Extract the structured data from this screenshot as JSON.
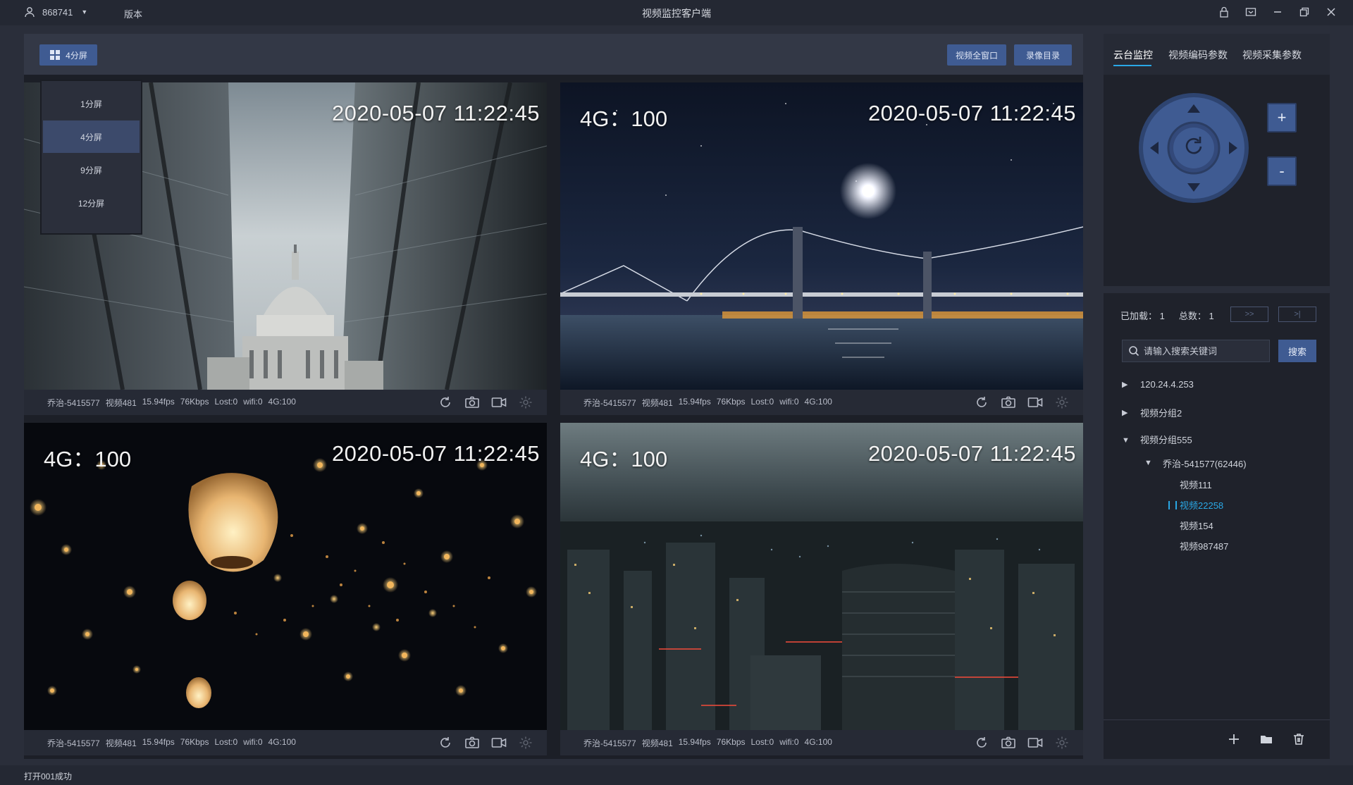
{
  "titlebar": {
    "user_id": "868741",
    "version_label": "版本",
    "app_title": "视频监控客户端"
  },
  "toolbar": {
    "split_label": "4分屏",
    "fullscreen_label": "视频全窗口",
    "record_dir_label": "录像目录"
  },
  "split_menu": {
    "options": [
      "1分屏",
      "4分屏",
      "9分屏",
      "12分屏"
    ],
    "selected": "4分屏"
  },
  "tiles": [
    {
      "signal": "",
      "timestamp": "2020-05-07 11:22:45",
      "status": [
        "乔治-5415577",
        "视频481",
        "15.94fps",
        "76Kbps",
        "Lost:0",
        "wifi:0",
        "4G:100"
      ],
      "selected": true
    },
    {
      "signal": "4G：100",
      "timestamp": "2020-05-07 11:22:45",
      "status": [
        "乔治-5415577",
        "视频481",
        "15.94fps",
        "76Kbps",
        "Lost:0",
        "wifi:0",
        "4G:100"
      ],
      "selected": false
    },
    {
      "signal": "4G：100",
      "timestamp": "2020-05-07 11:22:45",
      "status": [
        "乔治-5415577",
        "视频481",
        "15.94fps",
        "76Kbps",
        "Lost:0",
        "wifi:0",
        "4G:100"
      ],
      "selected": false
    },
    {
      "signal": "4G：100",
      "timestamp": "2020-05-07 11:22:45",
      "status": [
        "乔治-5415577",
        "视频481",
        "15.94fps",
        "76Kbps",
        "Lost:0",
        "wifi:0",
        "4G:100"
      ],
      "selected": false
    }
  ],
  "tile_icons": [
    "refresh-icon",
    "camera-icon",
    "video-record-icon",
    "settings-icon"
  ],
  "right_panel": {
    "tabs": [
      "云台监控",
      "视频编码参数",
      "视频采集参数"
    ],
    "active_tab": "云台监控",
    "zoom_in_label": "+",
    "zoom_out_label": "-"
  },
  "device_list": {
    "loaded_label": "已加载：",
    "loaded_value": "1",
    "total_label": "总数：",
    "total_value": "1",
    "next_page_label": ">>",
    "last_page_label": ">|",
    "search_placeholder": "请输入搜索关键词",
    "search_button": "搜索",
    "tree": {
      "ip_node": "120.24.4.253",
      "group2": "视频分组2",
      "group555": "视频分组555",
      "device": "乔治-541577(62446)",
      "channels": [
        "视频111",
        "视频22258",
        "视频154",
        "视频987487"
      ],
      "playing_channel": "视频22258"
    }
  },
  "footer": {
    "status": "打开001成功"
  },
  "colors": {
    "accent": "#3f5b92",
    "highlight": "#2aa8e6",
    "background": "#2a2e3a",
    "panel": "#1f222b"
  }
}
